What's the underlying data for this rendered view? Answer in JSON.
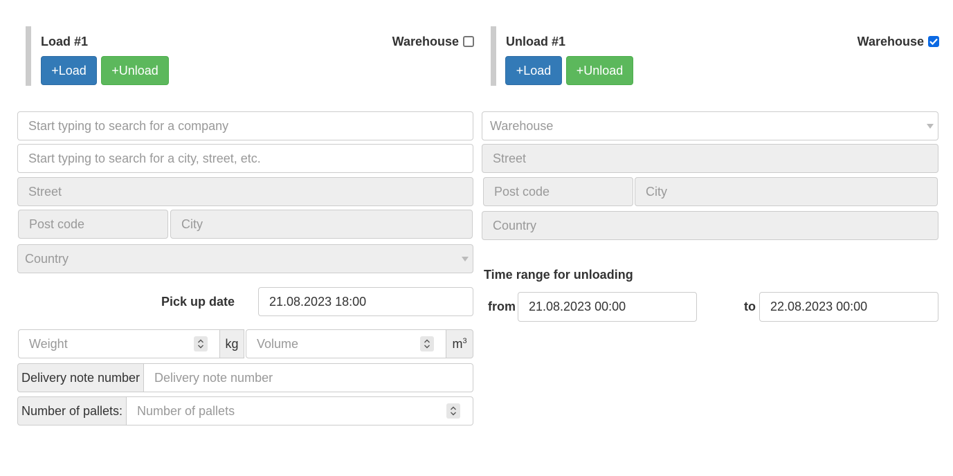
{
  "load": {
    "title": "Load #1",
    "warehouse_label": "Warehouse",
    "warehouse_checked": false,
    "add_load_label": "+Load",
    "add_unload_label": "+Unload",
    "company_placeholder": "Start typing to search for a company",
    "address_placeholder": "Start typing to search for a city, street, etc.",
    "street_placeholder": "Street",
    "postcode_placeholder": "Post code",
    "city_placeholder": "City",
    "country_placeholder": "Country",
    "pickup_label": "Pick up date",
    "pickup_value": "21.08.2023 18:00",
    "weight_placeholder": "Weight",
    "weight_unit": "kg",
    "volume_placeholder": "Volume",
    "volume_unit": "m",
    "volume_unit_sup": "3",
    "delivery_note_label": "Delivery note number",
    "delivery_note_placeholder": "Delivery note number",
    "pallets_label": "Number of pallets:",
    "pallets_placeholder": "Number of pallets"
  },
  "unload": {
    "title": "Unload #1",
    "warehouse_label": "Warehouse",
    "warehouse_checked": true,
    "add_load_label": "+Load",
    "add_unload_label": "+Unload",
    "warehouse_select_placeholder": "Warehouse",
    "street_placeholder": "Street",
    "postcode_placeholder": "Post code",
    "city_placeholder": "City",
    "country_placeholder": "Country",
    "time_range_label": "Time range for unloading",
    "from_label": "from",
    "from_value": "21.08.2023 00:00",
    "to_label": "to",
    "to_value": "22.08.2023 00:00"
  },
  "colors": {
    "primary": "#337ab7",
    "success": "#5cb85c",
    "checkbox_checked": "#0b69e3"
  }
}
